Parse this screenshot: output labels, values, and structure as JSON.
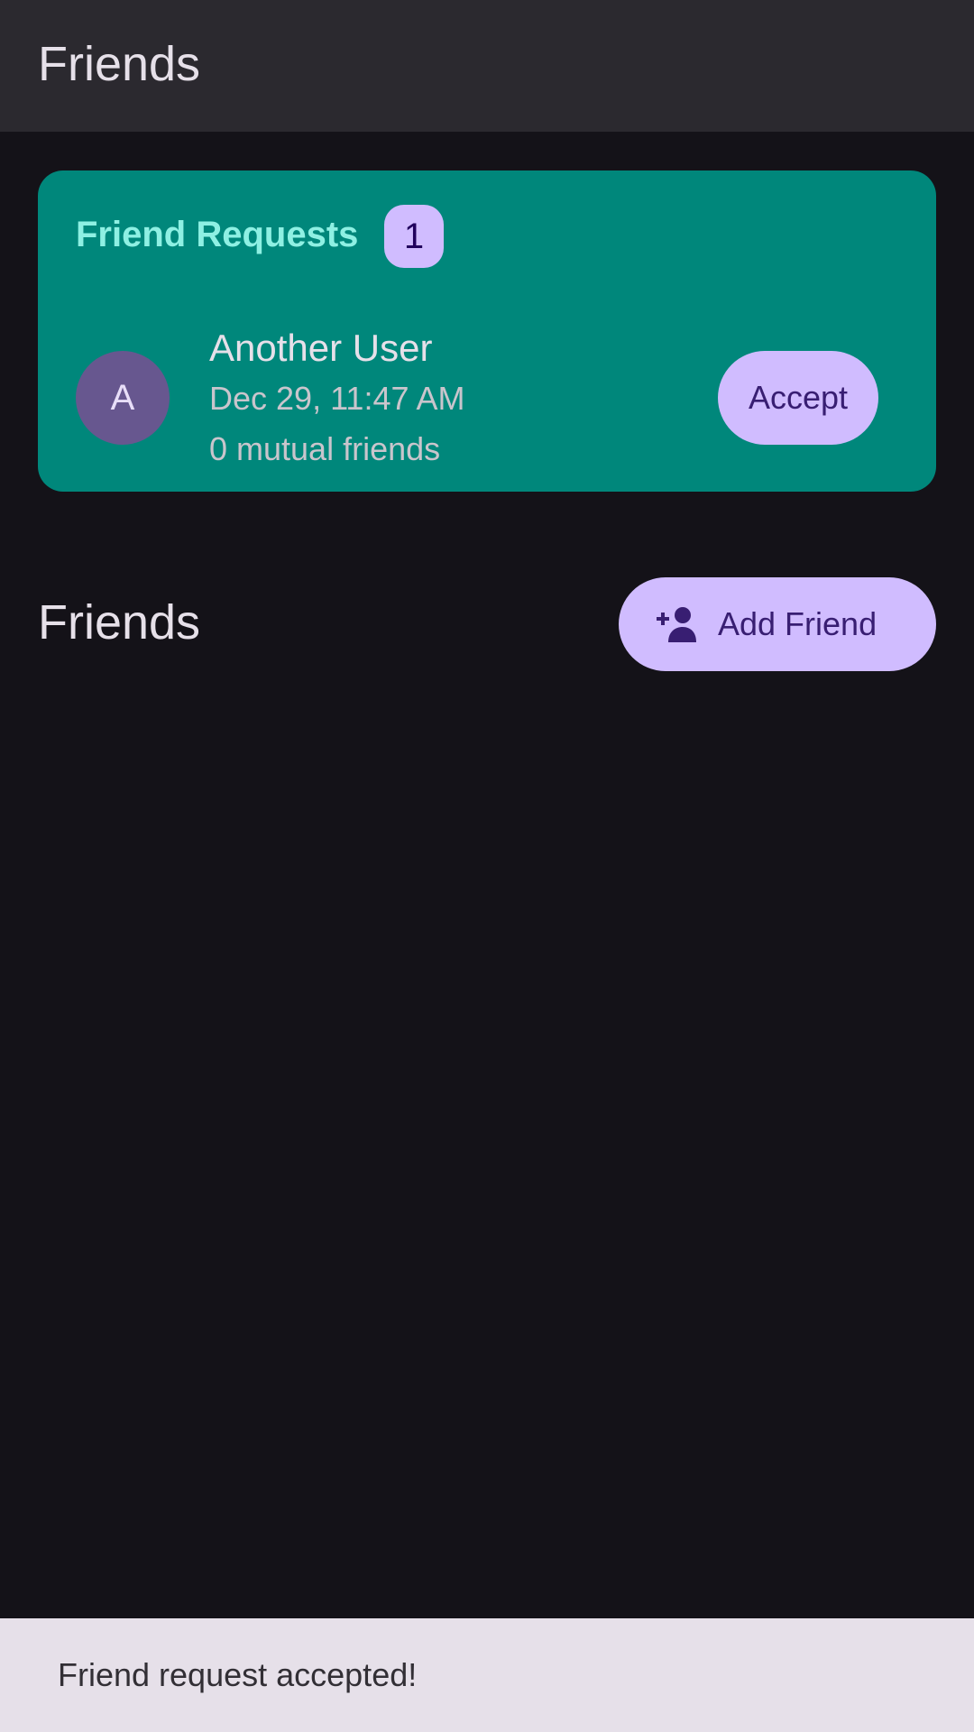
{
  "app_bar": {
    "title": "Friends"
  },
  "friend_requests": {
    "title": "Friend Requests",
    "count": "1",
    "items": [
      {
        "avatar_initial": "A",
        "name": "Another User",
        "date": "Dec 29, 11:47 AM",
        "mutual": "0 mutual friends",
        "accept_label": "Accept"
      }
    ]
  },
  "friends_section": {
    "heading": "Friends",
    "add_button_label": "Add Friend",
    "add_button_icon": "person-add-icon"
  },
  "snackbar": {
    "message": "Friend request accepted!"
  },
  "colors": {
    "background": "#141218",
    "app_bar": "#2b292f",
    "card": "#00877b",
    "card_title": "#8ef0e3",
    "primary_container": "#d0bcff",
    "avatar": "#67578f",
    "snackbar": "#e6e0e9"
  }
}
